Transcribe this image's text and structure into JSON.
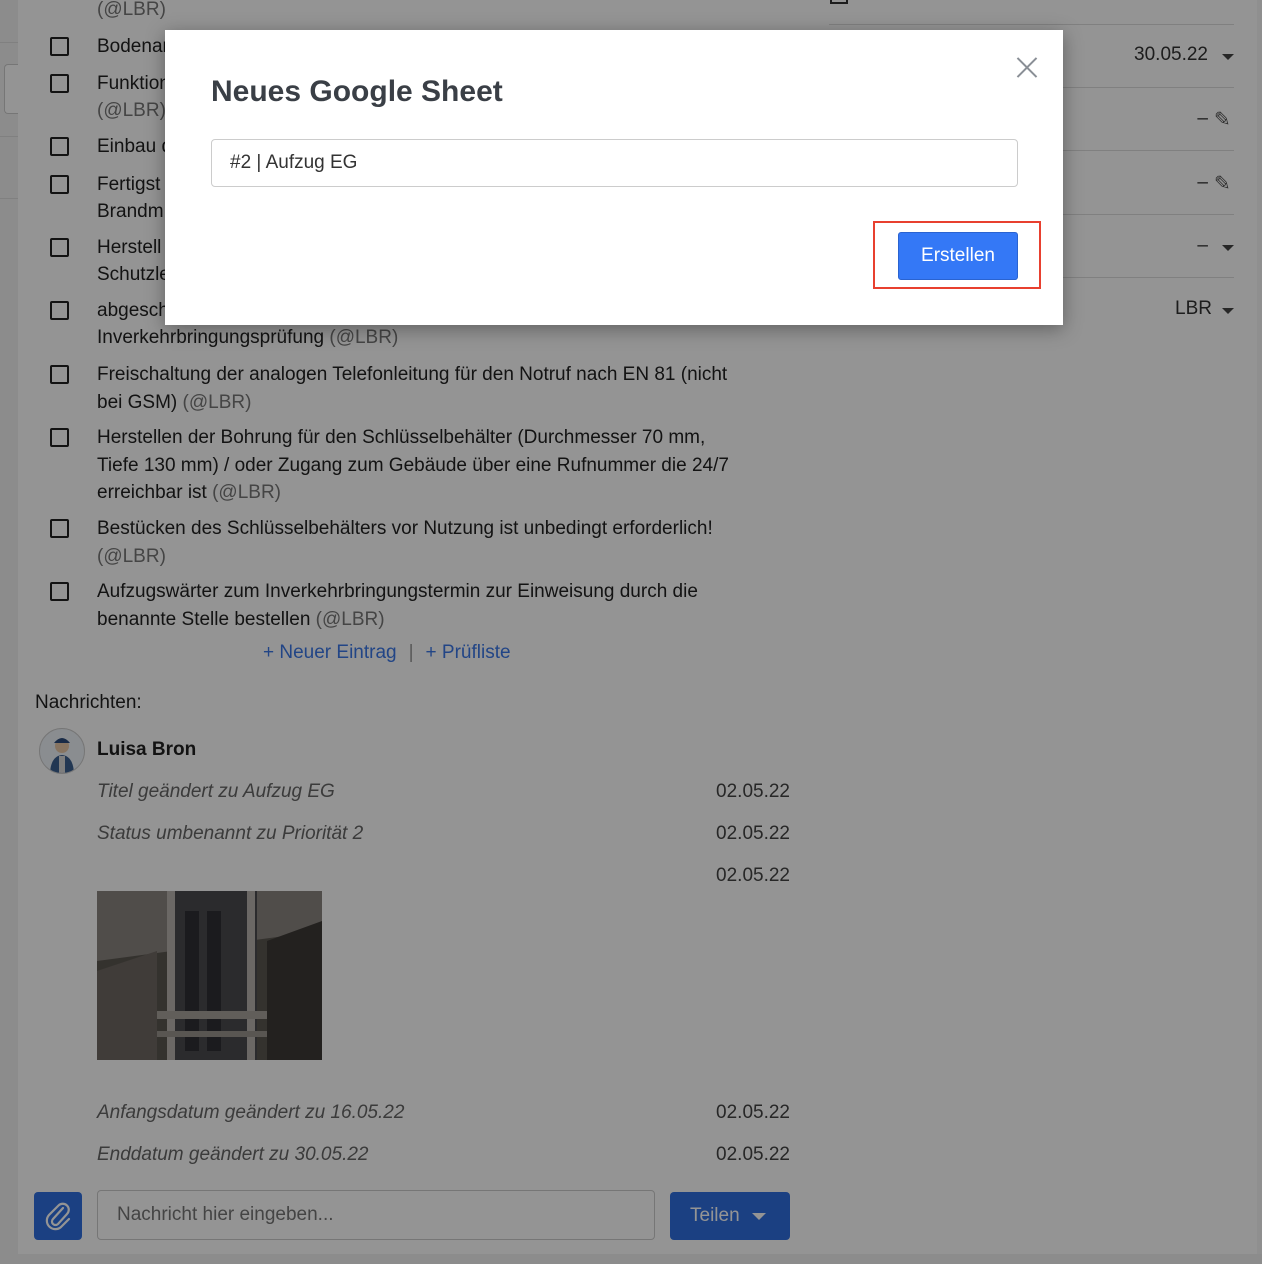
{
  "checklist": {
    "top_fragment": "(@LBR)",
    "items": [
      {
        "text": "Bodenan",
        "tag": ""
      },
      {
        "text": "Funktion",
        "tag": ""
      },
      {
        "text": "Einbau d",
        "tag": ""
      },
      {
        "text": "Fertigst",
        "tag": ""
      },
      {
        "text": "Herstell",
        "tag": ""
      },
      {
        "text": "abgesch",
        "tag": ""
      },
      {
        "text": "Freischaltung der analogen Telefonleitung für den Notruf nach EN 81 (nicht bei GSM)",
        "tag": "(@LBR)"
      },
      {
        "text": "Herstellen der Bohrung für den Schlüsselbehälter (Durchmesser 70 mm, Tiefe 130 mm) / oder Zugang zum Gebäude über eine Rufnummer die 24/7 erreichbar ist",
        "tag": "(@LBR)"
      },
      {
        "text": "Bestücken des Schlüsselbehälters vor Nutzung ist unbedingt erforderlich!",
        "tag": "(@LBR)"
      },
      {
        "text": "Aufzugswärter zum Inverkehrbringungstermin zur Einweisung durch die benannte Stelle bestellen",
        "tag": "(@LBR)"
      }
    ],
    "continuations": {
      "item2": "(@LBR)",
      "item4": "Brandm",
      "item5": "Schutzle",
      "item6_text": "Inverkehrbringungsprüfung",
      "item6_tag": "(@LBR)"
    },
    "new_entry_link": "+ Neuer Eintrag",
    "separator": "|",
    "checklist_link": "+ Prüfliste"
  },
  "messages": {
    "title": "Nachrichten:",
    "author": "Luisa Bron",
    "log": [
      {
        "text": "Titel geändert zu Aufzug EG",
        "date": "02.05.22"
      },
      {
        "text": "Status umbenannt zu Priorität 2",
        "date": "02.05.22"
      },
      {
        "text": "",
        "date": "02.05.22"
      },
      {
        "text": "Anfangsdatum geändert zu 16.05.22",
        "date": "02.05.22"
      },
      {
        "text": "Enddatum geändert zu 30.05.22",
        "date": "02.05.22"
      }
    ],
    "input_placeholder": "Nachricht hier eingeben...",
    "share_label": "Teilen"
  },
  "right_panel": {
    "date_value": "30.05.22",
    "dash1": "–",
    "dash2": "–",
    "dash3": "–",
    "assignee": "LBR"
  },
  "modal": {
    "title": "Neues Google Sheet",
    "input_value": "#2 | Aufzug EG",
    "create_label": "Erstellen"
  },
  "colors": {
    "accent": "#3478f6",
    "highlight": "#e8402f",
    "link": "#3b78e7"
  }
}
